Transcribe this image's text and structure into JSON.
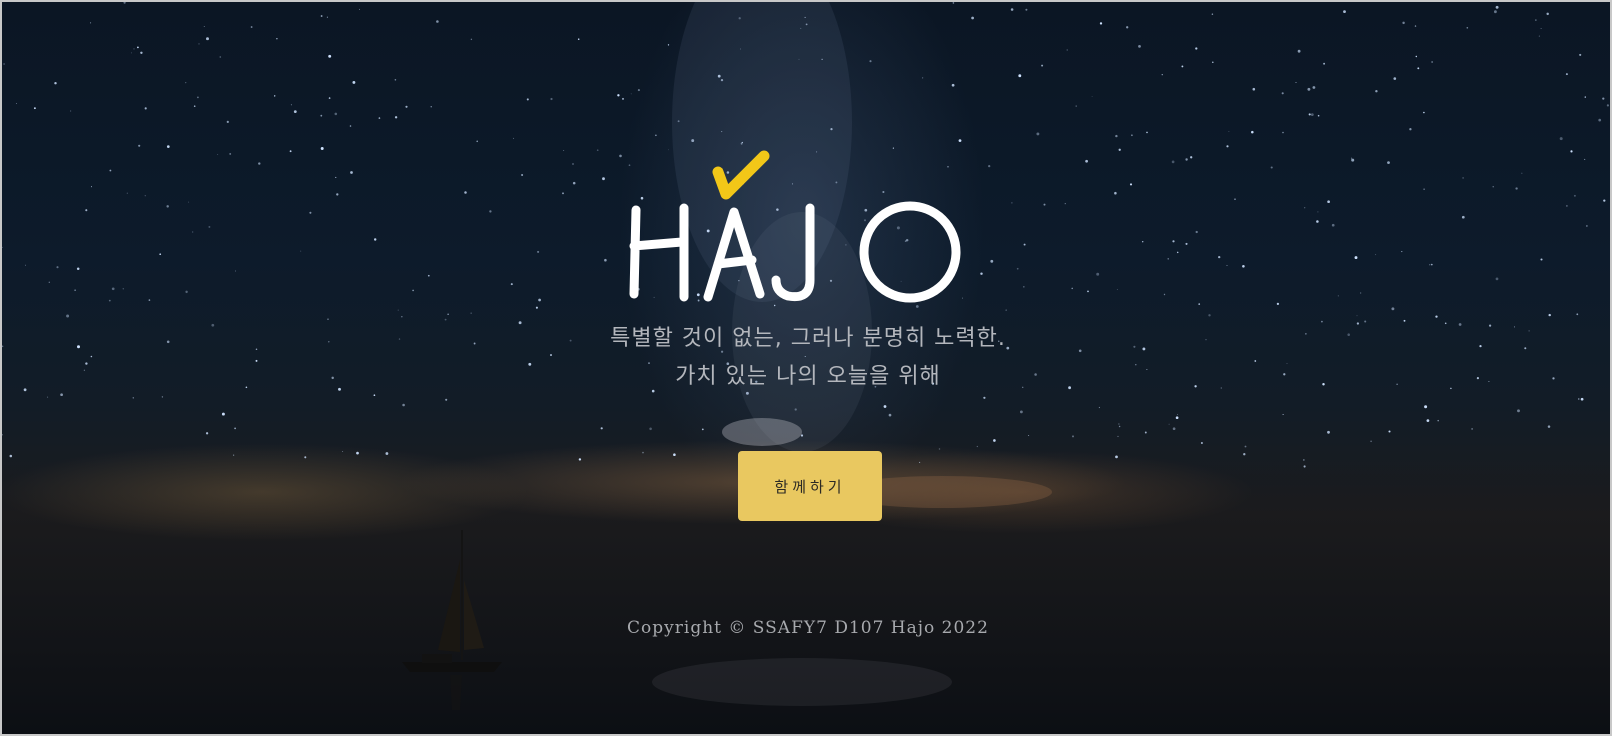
{
  "hero": {
    "logo_text": "HAJO",
    "tagline_line1": "특별할 것이 없는, 그러나 분명히 노력한.",
    "tagline_line2": "가치 있는 나의 오늘을 위해",
    "cta_label": "함께하기"
  },
  "footer": {
    "copyright": "Copyright © SSAFY7 D107 Hajo 2022"
  },
  "colors": {
    "accent": "#e9c860",
    "logo_check": "#f2c718",
    "logo_text": "#ffffff"
  }
}
